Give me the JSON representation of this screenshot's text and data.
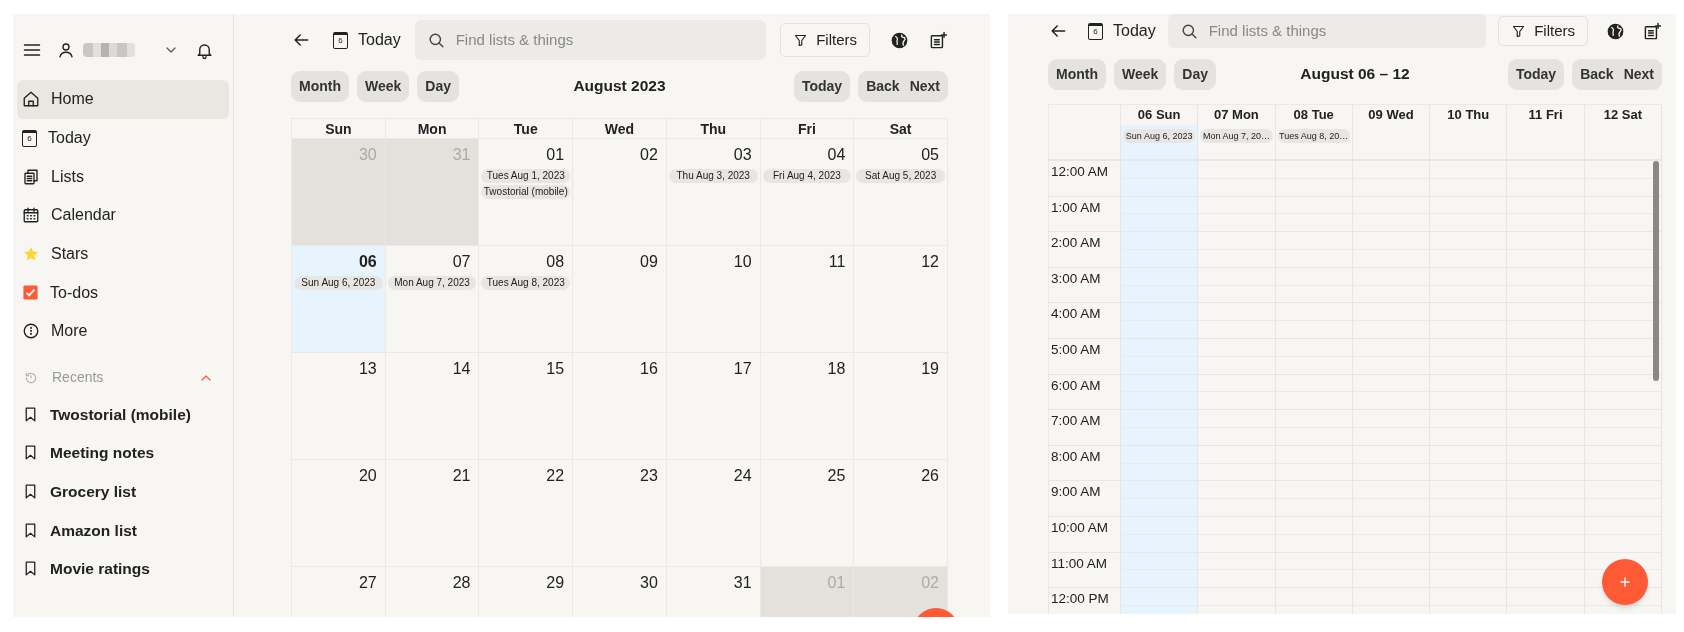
{
  "sidebar": {
    "items": [
      {
        "label": "Home",
        "kind": "home",
        "selected": true
      },
      {
        "label": "Today",
        "kind": "today",
        "day_number": "6",
        "selected": false
      },
      {
        "label": "Lists",
        "kind": "lists",
        "selected": false
      },
      {
        "label": "Calendar",
        "kind": "calendar",
        "selected": false
      },
      {
        "label": "Stars",
        "kind": "star",
        "selected": false
      },
      {
        "label": "To-dos",
        "kind": "todo",
        "selected": false
      },
      {
        "label": "More",
        "kind": "more",
        "selected": false
      }
    ],
    "recents": {
      "label": "Recents",
      "expanded": true,
      "items": [
        "Twostorial (mobile)",
        "Meeting notes",
        "Grocery list",
        "Amazon list",
        "Movie ratings"
      ]
    }
  },
  "month_view": {
    "toolbar": {
      "today_label": "Today",
      "day_number": "6",
      "search_placeholder": "Find lists & things",
      "filters": "Filters"
    },
    "views": [
      "Month",
      "Week",
      "Day"
    ],
    "title": "August 2023",
    "nav": {
      "today": "Today",
      "back": "Back",
      "next": "Next"
    },
    "weekdays": [
      "Sun",
      "Mon",
      "Tue",
      "Wed",
      "Thu",
      "Fri",
      "Sat"
    ],
    "weeks": [
      [
        {
          "day": "30",
          "outside": true,
          "today": false
        },
        {
          "day": "31",
          "outside": true,
          "today": false
        },
        {
          "day": "01",
          "outside": false,
          "today": false,
          "events": [
            "Tues Aug 1, 2023",
            "Twostorial (mobile)"
          ]
        },
        {
          "day": "02",
          "outside": false,
          "today": false
        },
        {
          "day": "03",
          "outside": false,
          "today": false,
          "events": [
            "Thu Aug 3, 2023"
          ]
        },
        {
          "day": "04",
          "outside": false,
          "today": false,
          "events": [
            "Fri Aug 4, 2023"
          ]
        },
        {
          "day": "05",
          "outside": false,
          "today": false,
          "events": [
            "Sat Aug 5, 2023"
          ]
        }
      ],
      [
        {
          "day": "06",
          "outside": false,
          "today": true,
          "events": [
            "Sun Aug 6, 2023"
          ]
        },
        {
          "day": "07",
          "outside": false,
          "today": false,
          "events": [
            "Mon Aug 7, 2023"
          ]
        },
        {
          "day": "08",
          "outside": false,
          "today": false,
          "events": [
            "Tues Aug 8, 2023"
          ]
        },
        {
          "day": "09",
          "outside": false,
          "today": false
        },
        {
          "day": "10",
          "outside": false,
          "today": false
        },
        {
          "day": "11",
          "outside": false,
          "today": false
        },
        {
          "day": "12",
          "outside": false,
          "today": false
        }
      ],
      [
        {
          "day": "13",
          "outside": false,
          "today": false
        },
        {
          "day": "14",
          "outside": false,
          "today": false
        },
        {
          "day": "15",
          "outside": false,
          "today": false
        },
        {
          "day": "16",
          "outside": false,
          "today": false
        },
        {
          "day": "17",
          "outside": false,
          "today": false
        },
        {
          "day": "18",
          "outside": false,
          "today": false
        },
        {
          "day": "19",
          "outside": false,
          "today": false
        }
      ],
      [
        {
          "day": "20",
          "outside": false,
          "today": false
        },
        {
          "day": "21",
          "outside": false,
          "today": false
        },
        {
          "day": "22",
          "outside": false,
          "today": false
        },
        {
          "day": "23",
          "outside": false,
          "today": false
        },
        {
          "day": "24",
          "outside": false,
          "today": false
        },
        {
          "day": "25",
          "outside": false,
          "today": false
        },
        {
          "day": "26",
          "outside": false,
          "today": false
        }
      ],
      [
        {
          "day": "27",
          "outside": false,
          "today": false
        },
        {
          "day": "28",
          "outside": false,
          "today": false
        },
        {
          "day": "29",
          "outside": false,
          "today": false
        },
        {
          "day": "30",
          "outside": false,
          "today": false
        },
        {
          "day": "31",
          "outside": false,
          "today": false
        },
        {
          "day": "01",
          "outside": true,
          "today": false
        },
        {
          "day": "02",
          "outside": true,
          "today": false
        }
      ]
    ]
  },
  "week_view": {
    "toolbar": {
      "today_label": "Today",
      "day_number": "6",
      "search_placeholder": "Find lists & things",
      "filters": "Filters"
    },
    "views": [
      "Month",
      "Week",
      "Day"
    ],
    "title": "August 06 – 12",
    "nav": {
      "today": "Today",
      "back": "Back",
      "next": "Next"
    },
    "days": [
      {
        "label": "06 Sun",
        "today": true,
        "events": [
          "Sun Aug 6, 2023"
        ]
      },
      {
        "label": "07 Mon",
        "today": false,
        "events": [
          "Mon Aug 7, 20…"
        ]
      },
      {
        "label": "08 Tue",
        "today": false,
        "events": [
          "Tues Aug 8, 20…"
        ]
      },
      {
        "label": "09 Wed",
        "today": false
      },
      {
        "label": "10 Thu",
        "today": false
      },
      {
        "label": "11 Fri",
        "today": false
      },
      {
        "label": "12 Sat",
        "today": false
      }
    ],
    "hours": [
      "12:00 AM",
      "1:00 AM",
      "2:00 AM",
      "3:00 AM",
      "4:00 AM",
      "5:00 AM",
      "6:00 AM",
      "7:00 AM",
      "8:00 AM",
      "9:00 AM",
      "10:00 AM",
      "11:00 AM",
      "12:00 PM"
    ]
  }
}
